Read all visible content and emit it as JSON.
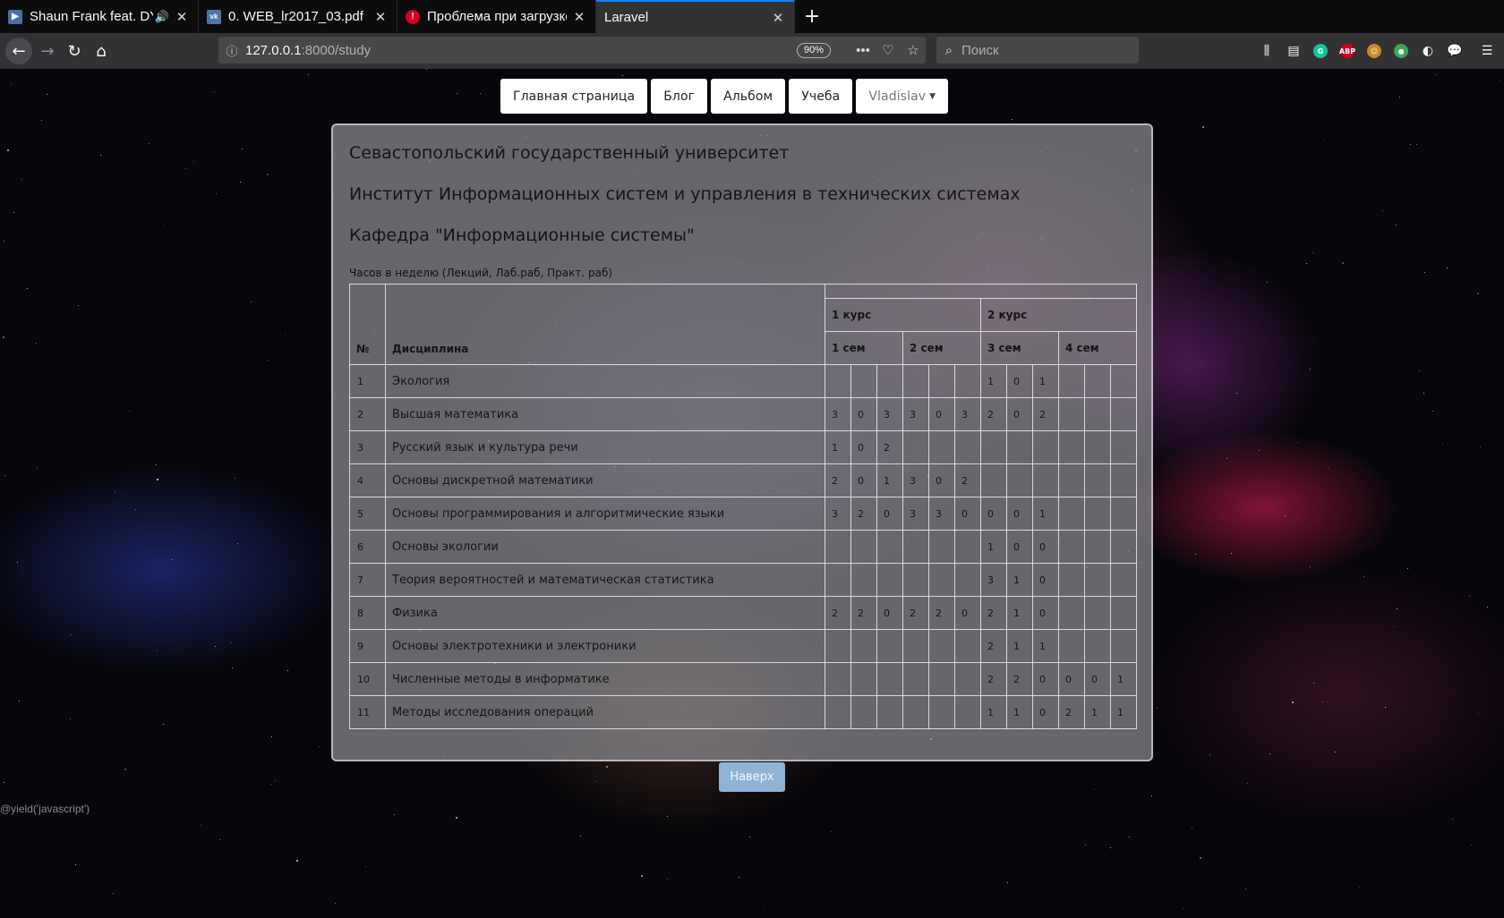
{
  "browser": {
    "tabs": [
      {
        "title": "Shaun Frank feat. DYS",
        "favicon_color": "#4a6fa5",
        "favicon_glyph": "▶",
        "has_audio": true
      },
      {
        "title": "0. WEB_lr2017_03.pdf",
        "favicon_color": "#4a76a8",
        "favicon_glyph": "vk",
        "has_audio": false
      },
      {
        "title": "Проблема при загрузке",
        "favicon_color": "#d70022",
        "favicon_glyph": "!",
        "has_audio": false
      },
      {
        "title": "Laravel",
        "favicon_color": "",
        "favicon_glyph": "",
        "has_audio": false
      }
    ],
    "active_tab": 3,
    "url_host": "127.0.0.1",
    "url_path": ":8000/study",
    "zoom": "90%",
    "search_placeholder": "Поиск"
  },
  "nav": {
    "items": [
      "Главная страница",
      "Блог",
      "Альбом",
      "Учеба"
    ],
    "user": "Vladislav"
  },
  "content": {
    "university": "Севастопольский государственный университет",
    "institute": "Институт Информационных систем и управления в технических системах",
    "department": "Кафедра \"Информационные системы\"",
    "caption": "Часов в неделю (Лекций, Лаб.раб, Практ. раб)",
    "table": {
      "col_number": "№",
      "col_discipline": "Дисциплина",
      "courses": [
        "1 курс",
        "2 курс"
      ],
      "semesters": [
        "1 сем",
        "2 сем",
        "3 сем",
        "4 сем"
      ],
      "rows": [
        {
          "n": "1",
          "name": "Экология",
          "h": [
            "",
            "",
            "",
            "",
            "",
            "",
            "1",
            "0",
            "1",
            "",
            "",
            ""
          ]
        },
        {
          "n": "2",
          "name": "Высшая математика",
          "h": [
            "3",
            "0",
            "3",
            "3",
            "0",
            "3",
            "2",
            "0",
            "2",
            "",
            "",
            ""
          ]
        },
        {
          "n": "3",
          "name": "Русский язык и культура речи",
          "h": [
            "1",
            "0",
            "2",
            "",
            "",
            "",
            "",
            "",
            "",
            "",
            "",
            ""
          ]
        },
        {
          "n": "4",
          "name": "Основы дискретной математики",
          "h": [
            "2",
            "0",
            "1",
            "3",
            "0",
            "2",
            "",
            "",
            "",
            "",
            "",
            ""
          ]
        },
        {
          "n": "5",
          "name": "Основы программирования и алгоритмические языки",
          "h": [
            "3",
            "2",
            "0",
            "3",
            "3",
            "0",
            "0",
            "0",
            "1",
            "",
            "",
            ""
          ]
        },
        {
          "n": "6",
          "name": "Основы экологии",
          "h": [
            "",
            "",
            "",
            "",
            "",
            "",
            "1",
            "0",
            "0",
            "",
            "",
            ""
          ]
        },
        {
          "n": "7",
          "name": "Теория вероятностей и математическая статистика",
          "h": [
            "",
            "",
            "",
            "",
            "",
            "",
            "3",
            "1",
            "0",
            "",
            "",
            ""
          ]
        },
        {
          "n": "8",
          "name": "Физика",
          "h": [
            "2",
            "2",
            "0",
            "2",
            "2",
            "0",
            "2",
            "1",
            "0",
            "",
            "",
            ""
          ]
        },
        {
          "n": "9",
          "name": "Основы электротехники и электроники",
          "h": [
            "",
            "",
            "",
            "",
            "",
            "",
            "2",
            "1",
            "1",
            "",
            "",
            ""
          ]
        },
        {
          "n": "10",
          "name": "Численные методы в информатике",
          "h": [
            "",
            "",
            "",
            "",
            "",
            "",
            "2",
            "2",
            "0",
            "0",
            "0",
            "1"
          ]
        },
        {
          "n": "11",
          "name": "Методы исследования операций",
          "h": [
            "",
            "",
            "",
            "",
            "",
            "",
            "1",
            "1",
            "0",
            "2",
            "1",
            "1"
          ]
        }
      ]
    },
    "up_button": "Наверх",
    "yield_text": "@yield('javascript')"
  }
}
